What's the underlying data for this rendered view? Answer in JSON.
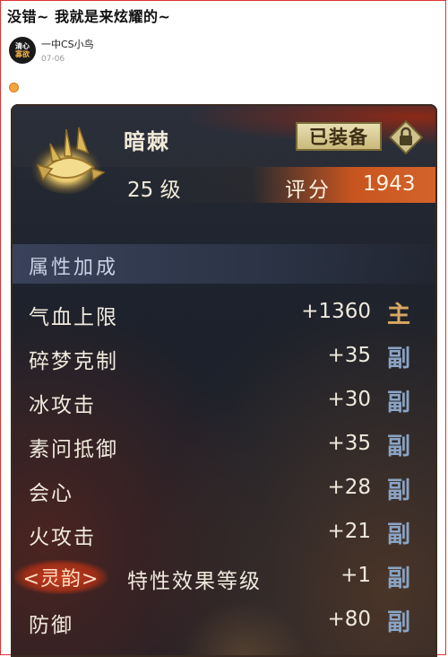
{
  "post": {
    "title": "没错~ 我就是来炫耀的~",
    "author": {
      "avatar_line1": "清心",
      "avatar_line2": "寡欲",
      "name": "一中CS小鸟"
    },
    "date": "07-06"
  },
  "item": {
    "name": "暗棘",
    "equipped_label": "已装备",
    "level": "25 级",
    "score_label": "评分",
    "score": "1943",
    "section_title": "属性加成",
    "attributes": [
      {
        "name": "气血上限",
        "value": "+1360",
        "type": "主"
      },
      {
        "name": "碎梦克制",
        "value": "+35",
        "type": "副"
      },
      {
        "name": "冰攻击",
        "value": "+30",
        "type": "副"
      },
      {
        "name": "素问抵御",
        "value": "+35",
        "type": "副"
      },
      {
        "name": "会心",
        "value": "+28",
        "type": "副"
      },
      {
        "name": "火攻击",
        "value": "+21",
        "type": "副"
      },
      {
        "tag": "<灵韵>",
        "name": "特性效果等级",
        "value": "+1",
        "type": "副"
      },
      {
        "name": "防御",
        "value": "+80",
        "type": "副"
      }
    ]
  },
  "colors": {
    "main_type": "#d8a862",
    "sub_type": "#8aa4c4",
    "accent_orange": "#d4632a"
  },
  "icons": {
    "item": "thorn-crown-icon",
    "lock": "lock-icon",
    "emoji": "face-emoji-icon"
  }
}
